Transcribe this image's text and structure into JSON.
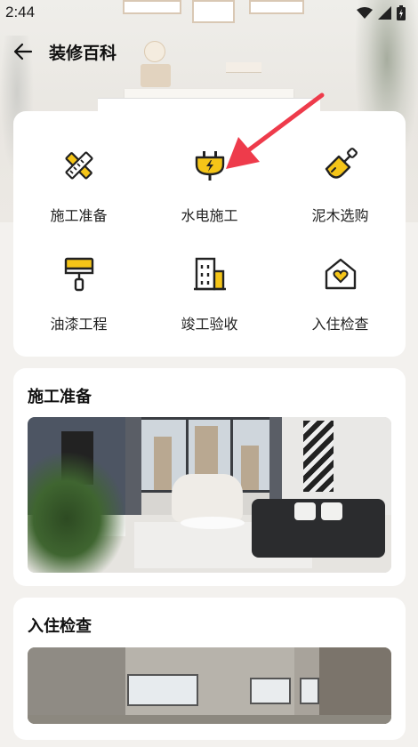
{
  "status_bar": {
    "time": "2:44"
  },
  "header": {
    "title": "装修百科"
  },
  "categories": [
    {
      "label": "施工准备",
      "icon": "pencil-ruler-icon"
    },
    {
      "label": "水电施工",
      "icon": "plug-icon"
    },
    {
      "label": "泥木选购",
      "icon": "trowel-icon"
    },
    {
      "label": "油漆工程",
      "icon": "paint-roller-icon"
    },
    {
      "label": "竣工验收",
      "icon": "building-icon"
    },
    {
      "label": "入住检查",
      "icon": "home-heart-icon"
    }
  ],
  "sections": [
    {
      "title": "施工准备"
    },
    {
      "title": "入住检查"
    }
  ],
  "colors": {
    "accent": "#f5c518",
    "icon_stroke": "#222222",
    "annotation": "#ee3b4b"
  }
}
